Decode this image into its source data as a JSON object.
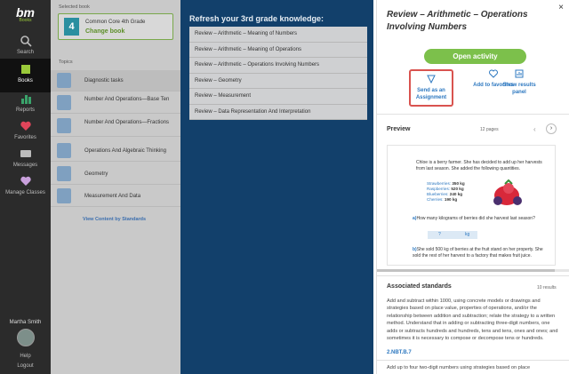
{
  "rail": {
    "logo": "bm",
    "logo_sub": "Books",
    "items": [
      {
        "label": "Search",
        "icon": "search-icon"
      },
      {
        "label": "Books",
        "icon": "books-icon",
        "active": true
      },
      {
        "label": "Reports",
        "icon": "reports-icon"
      },
      {
        "label": "Favorites",
        "icon": "heart-icon"
      },
      {
        "label": "Messages",
        "icon": "messages-icon"
      },
      {
        "label": "Manage Classes",
        "icon": "classes-icon"
      }
    ],
    "user_name": "Martha Smith",
    "help": "Help",
    "logout": "Logout"
  },
  "books": {
    "selected_label": "Selected book",
    "grade_number": "4",
    "book_title": "Common Core 4th Grade",
    "change_label": "Change book",
    "topics_label": "Topics",
    "topics": [
      "Diagnostic tasks",
      "Number And Operations—Base Ten",
      "Number And Operations—Fractions",
      "Operations And Algebraic Thinking",
      "Geometry",
      "Measurement And Data"
    ],
    "view_standards": "View Content by Standards"
  },
  "refresh": {
    "title": "Refresh your 3rd grade knowledge:",
    "items": [
      "Review – Arithmetic – Meaning of Numbers",
      "Review – Arithmetic – Meaning of Operations",
      "Review – Arithmetic – Operations Involving Numbers",
      "Review – Geometry",
      "Review – Measurement",
      "Review – Data Representation And Interpretation"
    ]
  },
  "detail": {
    "title": "Review – Arithmetic – Operations Involving Numbers",
    "open_activity": "Open activity",
    "send_assignment": "Send as an Assignment",
    "add_favorites": "Add to favorites",
    "show_results": "Show results panel",
    "preview_label": "Preview",
    "pages": "12 pages",
    "page": {
      "intro": "Chloe is a berry farmer. She has decided to add up her harvests from last season. She added the following quantities.",
      "rows": [
        {
          "name": "Strawberries:",
          "value": "350 kg"
        },
        {
          "name": "Raspberries:",
          "value": "520 kg"
        },
        {
          "name": "Blueberries:",
          "value": "240 kg"
        },
        {
          "name": "Cherries:",
          "value": "190 kg"
        }
      ],
      "qa_letter": "a)",
      "qa_text": "How many kilograms of berries did she harvest last season?",
      "answer_q": "?",
      "answer_unit": "kg",
      "qb_letter": "b)",
      "qb_text": "She sold 500 kg of berries at the fruit stand on her property. She sold the rest of her harvest to a factory that makes fruit juice."
    },
    "assoc_label": "Associated standards",
    "assoc_count": "10 results",
    "std_text": "Add and subtract within 1000, using concrete models or drawings and strategies based on place value, properties of operations, and/or the relationship between addition and subtraction; relate the strategy to a written method. Understand that in adding or subtracting three-digit numbers, one adds or subtracts hundreds and hundreds, tens and tens, ones and ones; and sometimes it is necessary to compose or decompose tens or hundreds.",
    "std_code": "2.NBT.B.7",
    "std_text2": "Add up to four two-digit numbers using strategies based on place"
  },
  "colors": {
    "rail": "#2b2b2b",
    "accent_green": "#7cc04b",
    "link_blue": "#2d78c0",
    "mid_bg": "#12406b",
    "highlight_red": "#d9534f"
  }
}
